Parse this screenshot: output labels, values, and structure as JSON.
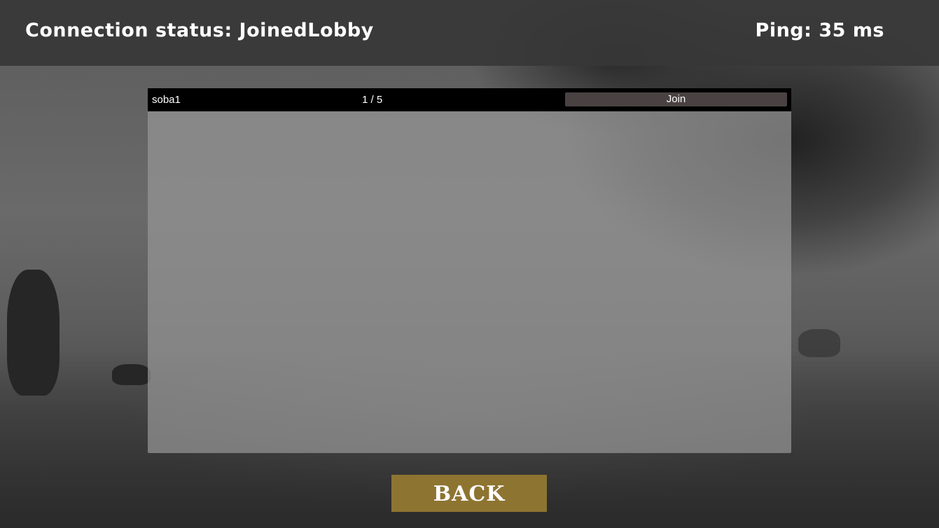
{
  "header": {
    "connection_status": "Connection status: JoinedLobby",
    "ping": "Ping: 35 ms"
  },
  "room_list": {
    "rooms": [
      {
        "name": "soba1",
        "players": "1 / 5",
        "join_label": "Join"
      }
    ]
  },
  "footer": {
    "back_label": "BACK"
  },
  "colors": {
    "topbar": "#373737",
    "room_row": "#000000",
    "join_button": "#4a4242",
    "back_button": "#8d7431",
    "panel": "#969696"
  }
}
